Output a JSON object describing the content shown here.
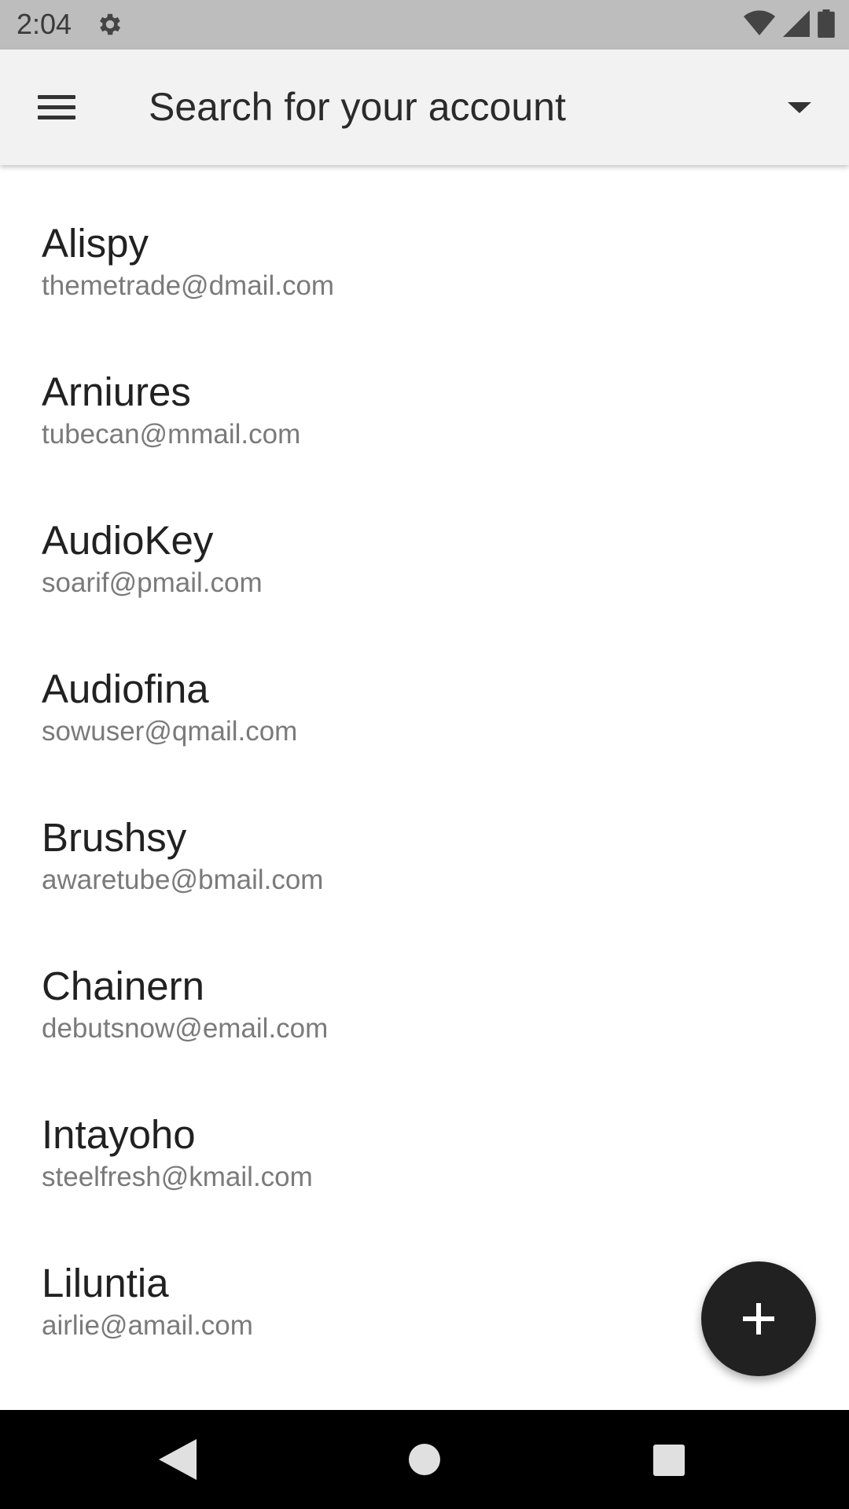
{
  "status_bar": {
    "time": "2:04",
    "icons": [
      "gear-icon",
      "wifi-icon",
      "signal-icon",
      "battery-icon"
    ]
  },
  "toolbar": {
    "menu_icon": "menu-icon",
    "title": "Search for your account",
    "dropdown_icon": "arrow-drop-down-icon",
    "background": "#f2f2f2"
  },
  "accounts": [
    {
      "name": "Alispy",
      "email": "themetrade@dmail.com"
    },
    {
      "name": "Arniures",
      "email": "tubecan@mmail.com"
    },
    {
      "name": "AudioKey",
      "email": "soarif@pmail.com"
    },
    {
      "name": "Audiofina",
      "email": "sowuser@qmail.com"
    },
    {
      "name": "Brushsy",
      "email": "awaretube@bmail.com"
    },
    {
      "name": "Chainern",
      "email": "debutsnow@email.com"
    },
    {
      "name": "Intayoho",
      "email": "steelfresh@kmail.com"
    },
    {
      "name": "Liluntia",
      "email": "airlie@amail.com"
    }
  ],
  "fab": {
    "icon": "plus-icon",
    "color": "#212121"
  },
  "nav_bar": {
    "icons": [
      "back-icon",
      "home-icon",
      "recents-icon"
    ]
  }
}
